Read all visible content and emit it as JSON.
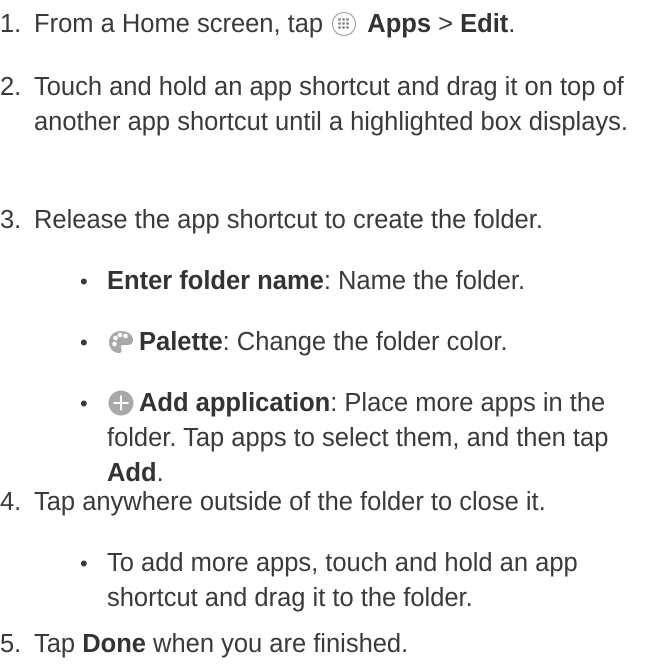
{
  "steps": [
    {
      "num": "1.",
      "pre": "From a Home screen, tap ",
      "icon": "apps-grid-icon",
      "bold1": "Apps",
      "mid": " > ",
      "bold2": "Edit",
      "post": "."
    },
    {
      "num": "2.",
      "text": "Touch and hold an app shortcut and drag it on top of another app shortcut until a highlighted box displays."
    },
    {
      "num": "3.",
      "text": "Release the app shortcut to create the folder."
    },
    {
      "num": "4.",
      "text": "Tap anywhere outside of the folder to close it."
    },
    {
      "num": "5.",
      "pre": "Tap ",
      "bold": "Done",
      "post": " when you are finished."
    }
  ],
  "bullets": {
    "folder_name": {
      "bold": "Enter folder name",
      "text": ": Name the folder."
    },
    "palette": {
      "icon": "palette-icon",
      "bold": "Palette",
      "text": ": Change the folder color."
    },
    "add_app": {
      "icon": "add-circle-icon",
      "bold": "Add application",
      "text": ": Place more apps in the folder. Tap apps to select them, and then tap ",
      "bold2": "Add",
      "post": "."
    },
    "more_apps": {
      "text": "To add more apps, touch and hold an app shortcut and drag it to the folder."
    }
  },
  "bullet_char": "•",
  "colors": {
    "text": "#3a3a3a",
    "icon_gray": "#a8a8a8"
  }
}
